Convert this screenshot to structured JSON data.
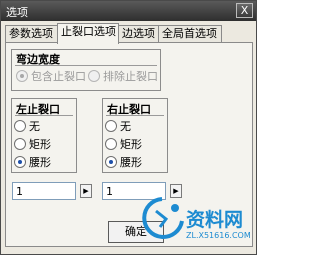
{
  "window": {
    "title": "选项",
    "close_label": "X"
  },
  "tabs": [
    {
      "label": "参数选项",
      "active": false
    },
    {
      "label": "止裂口选项",
      "active": true
    },
    {
      "label": "边选项",
      "active": false
    },
    {
      "label": "全局首选项",
      "active": false
    }
  ],
  "bend_width": {
    "title": "弯边宽度",
    "options": [
      {
        "label": "包含止裂口",
        "checked": true,
        "disabled": true
      },
      {
        "label": "排除止裂口",
        "checked": false,
        "disabled": true
      }
    ]
  },
  "left_relief": {
    "title": "左止裂口",
    "options": [
      {
        "label": "无",
        "checked": false
      },
      {
        "label": "矩形",
        "checked": false
      },
      {
        "label": "腰形",
        "checked": true
      }
    ],
    "value": "1"
  },
  "right_relief": {
    "title": "右止裂口",
    "options": [
      {
        "label": "无",
        "checked": false
      },
      {
        "label": "矩形",
        "checked": false
      },
      {
        "label": "腰形",
        "checked": true
      }
    ],
    "value": "1"
  },
  "footer": {
    "ok_label": "确定"
  },
  "watermark": {
    "text": "资料网",
    "url": "ZL.X51616.COM"
  },
  "colors": {
    "titlebar": "#3c3c3c",
    "radio_fill": "#1e4fa8",
    "watermark": "#1d8bd1"
  }
}
